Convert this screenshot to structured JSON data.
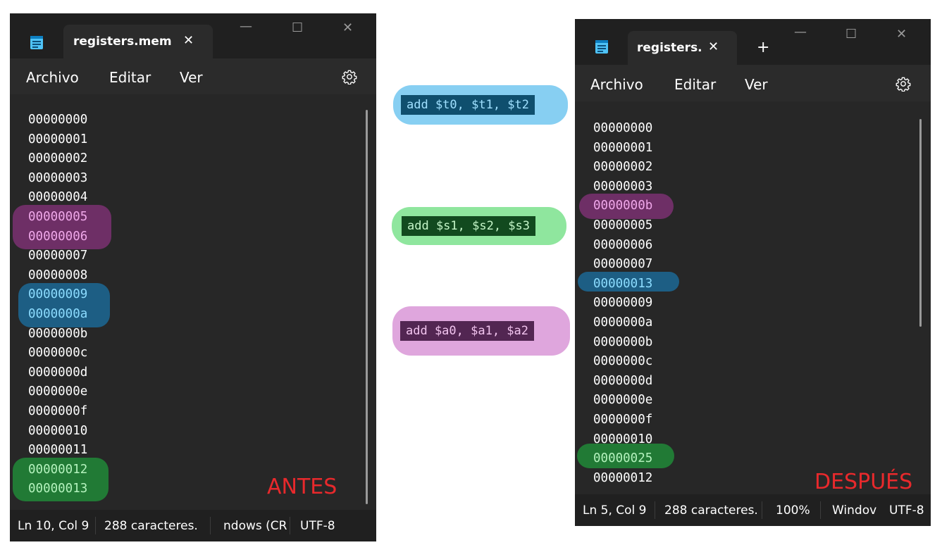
{
  "left_window": {
    "tab_title": "registers.mem",
    "menu": [
      "Archivo",
      "Editar",
      "Ver"
    ],
    "lines": [
      "00000000",
      "00000001",
      "00000002",
      "00000003",
      "00000004",
      "00000005",
      "00000006",
      "00000007",
      "00000008",
      "00000009",
      "0000000a",
      "0000000b",
      "0000000c",
      "0000000d",
      "0000000e",
      "0000000f",
      "00000010",
      "00000011",
      "00000012",
      "00000013"
    ],
    "label": "ANTES",
    "status": {
      "position": "Ln 10, Col 9",
      "chars": "288 caracteres.",
      "eol": "ndows (CR",
      "encoding": "UTF-8"
    }
  },
  "right_window": {
    "tab_title": "registers.",
    "menu": [
      "Archivo",
      "Editar",
      "Ver"
    ],
    "lines": [
      "00000000",
      "00000001",
      "00000002",
      "00000003",
      "0000000b",
      "00000005",
      "00000006",
      "00000007",
      "00000013",
      "00000009",
      "0000000a",
      "0000000b",
      "0000000c",
      "0000000d",
      "0000000e",
      "0000000f",
      "00000010",
      "00000025",
      "00000012"
    ],
    "label": "DESPUÉS",
    "status": {
      "position": "Ln 5, Col 9",
      "chars": "288 caracteres.",
      "zoom": "100%",
      "eol": "Windov",
      "encoding": "UTF-8"
    }
  },
  "instructions": [
    {
      "text": "add $t0, $t1, $t2",
      "highlight": "#87cff2",
      "box": "#0f4f6e",
      "fg": "#9fe0ff"
    },
    {
      "text": "add $s1, $s2, $s3",
      "highlight": "#8fe69e",
      "box": "#124a1f",
      "fg": "#c4f5c8"
    },
    {
      "text": "add $a0, $a1, $a2",
      "highlight": "#dfa6dd",
      "box": "#522652",
      "fg": "#f2c4ef"
    }
  ],
  "colors": {
    "purple": "#6e2f66",
    "blue": "#1d5e84",
    "green": "#217a35",
    "stamp": "#e8292c"
  }
}
